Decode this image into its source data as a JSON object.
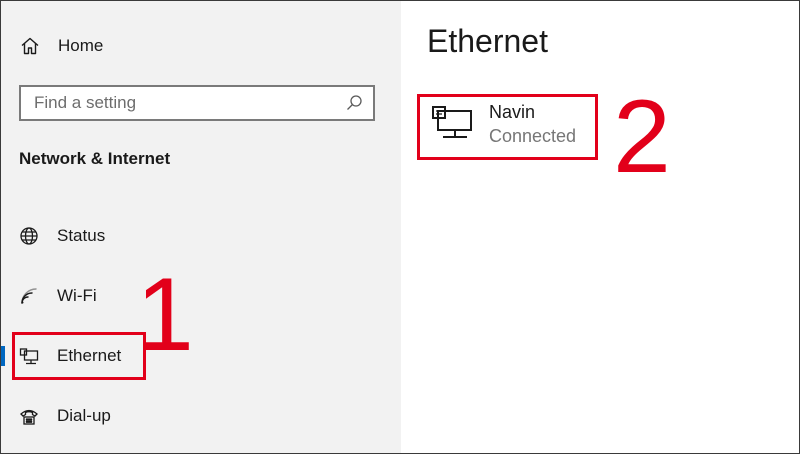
{
  "sidebar": {
    "home": {
      "label": "Home",
      "icon": "home-icon"
    },
    "search": {
      "placeholder": "Find a setting",
      "value": "",
      "icon": "search-icon"
    },
    "section_title": "Network & Internet",
    "items": [
      {
        "label": "Status",
        "icon": "globe-icon",
        "selected": false
      },
      {
        "label": "Wi-Fi",
        "icon": "wifi-icon",
        "selected": false
      },
      {
        "label": "Ethernet",
        "icon": "ethernet-icon",
        "selected": true
      },
      {
        "label": "Dial-up",
        "icon": "dialup-icon",
        "selected": false
      }
    ]
  },
  "main": {
    "title": "Ethernet",
    "connection": {
      "name": "Navin",
      "status": "Connected",
      "icon": "ethernet-network-icon"
    }
  },
  "annotations": {
    "step1": "1",
    "step2": "2",
    "color": "#e2001a"
  },
  "colors": {
    "sidebar_bg": "#f2f2f2",
    "main_bg": "#ffffff",
    "accent": "#0067c0",
    "secondary_text": "#767676"
  }
}
